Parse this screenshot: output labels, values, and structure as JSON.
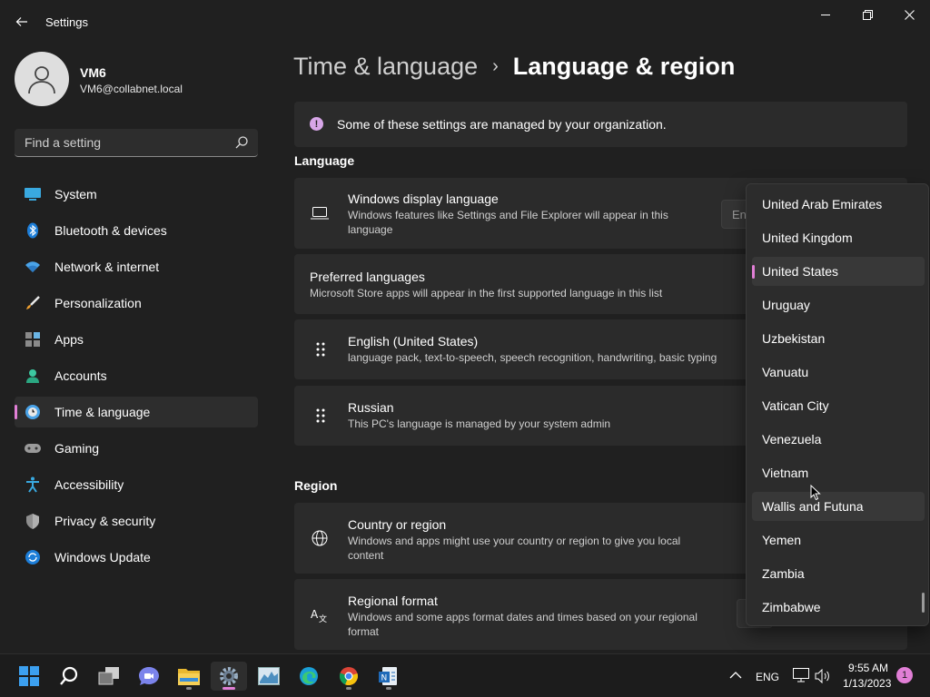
{
  "window": {
    "title": "Settings",
    "back_icon": "back-arrow-icon",
    "controls": [
      "minimize-icon",
      "restore-icon",
      "close-icon"
    ]
  },
  "profile": {
    "name": "VM6",
    "email": "VM6@collabnet.local"
  },
  "search": {
    "placeholder": "Find a setting"
  },
  "sidebar": {
    "accent_color": "#e17fd6",
    "items": [
      {
        "label": "System",
        "icon": "system-icon"
      },
      {
        "label": "Bluetooth & devices",
        "icon": "bluetooth-icon"
      },
      {
        "label": "Network & internet",
        "icon": "network-icon"
      },
      {
        "label": "Personalization",
        "icon": "brush-icon"
      },
      {
        "label": "Apps",
        "icon": "apps-icon"
      },
      {
        "label": "Accounts",
        "icon": "accounts-icon"
      },
      {
        "label": "Time & language",
        "icon": "time-language-icon",
        "selected": true
      },
      {
        "label": "Gaming",
        "icon": "gamepad-icon"
      },
      {
        "label": "Accessibility",
        "icon": "accessibility-icon"
      },
      {
        "label": "Privacy & security",
        "icon": "shield-icon"
      },
      {
        "label": "Windows Update",
        "icon": "update-icon"
      }
    ]
  },
  "breadcrumb": {
    "parent": "Time & language",
    "separator": "›",
    "current": "Language & region"
  },
  "info": {
    "text": "Some of these settings are managed by your organization.",
    "icon": "info-icon"
  },
  "language_section": {
    "title": "Language",
    "display_language": {
      "title": "Windows display language",
      "desc_line1": "Windows features like Settings and File Explorer will appear in this",
      "desc_line2": "language",
      "dropdown_partial": "En"
    },
    "preferred": {
      "title": "Preferred languages",
      "desc": "Microsoft Store apps will appear in the first supported language in this list"
    },
    "languages": [
      {
        "name": "English (United States)",
        "desc": "language pack, text-to-speech, speech recognition, handwriting, basic typing"
      },
      {
        "name": "Russian",
        "desc": "This PC's language is managed by your system admin"
      }
    ]
  },
  "region_section": {
    "title": "Region",
    "country": {
      "title": "Country or region",
      "desc_line1": "Windows and apps might use your country or region to give you local",
      "desc_line2": "content"
    },
    "format": {
      "title": "Regional format",
      "desc_line1": "Windows and some apps format dates and times based on your regional",
      "desc_line2": "format"
    }
  },
  "country_dropdown": {
    "items": [
      "United Arab Emirates",
      "United Kingdom",
      "United States",
      "Uruguay",
      "Uzbekistan",
      "Vanuatu",
      "Vatican City",
      "Venezuela",
      "Vietnam",
      "Wallis and Futuna",
      "Yemen",
      "Zambia",
      "Zimbabwe"
    ],
    "selected": "United States",
    "hovered": "Wallis and Futuna"
  },
  "taskbar": {
    "apps": [
      "start-icon",
      "search-icon",
      "task-view-icon",
      "teams-chat-icon",
      "file-explorer-icon",
      "settings-icon",
      "resource-monitor-icon",
      "edge-icon",
      "chrome-icon",
      "notepad-app-icon"
    ],
    "active_app": "settings-icon",
    "language": "ENG",
    "time": "9:55 AM",
    "date": "1/13/2023",
    "notifications": "1"
  }
}
